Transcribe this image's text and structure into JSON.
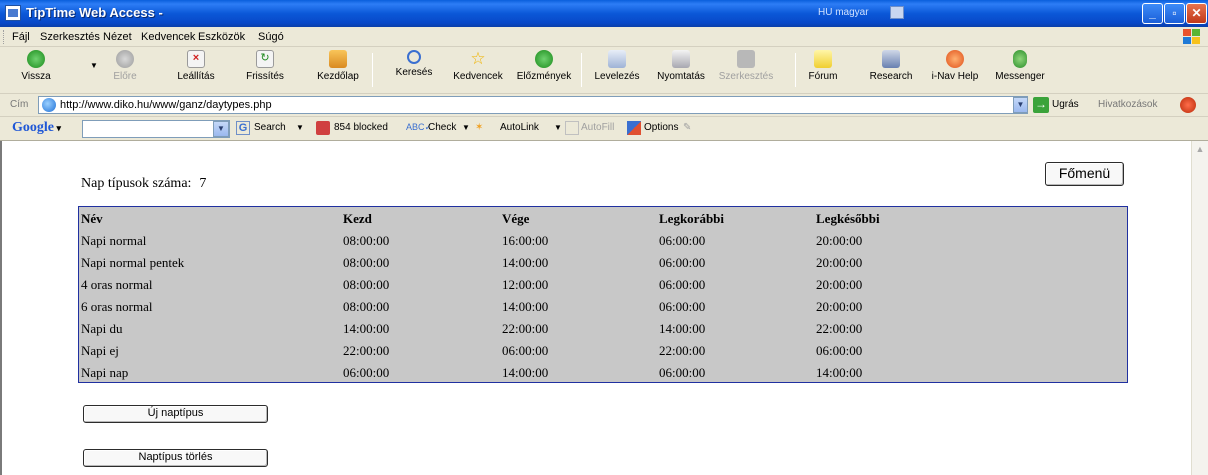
{
  "window": {
    "title": "TipTime Web Access -",
    "language": "HU magyar"
  },
  "menu": [
    "Fájl",
    "Szerkesztés",
    "Nézet",
    "Kedvencek",
    "Eszközök",
    "Súgó"
  ],
  "toolbar": {
    "back": "Vissza",
    "forward": "Előre",
    "stop": "Leállítás",
    "refresh": "Frissítés",
    "home": "Kezdőlap",
    "search": "Keresés",
    "favorites": "Kedvencek",
    "history": "Előzmények",
    "mail": "Levelezés",
    "print": "Nyomtatás",
    "edit": "Szerkesztés",
    "forum": "Fórum",
    "research": "Research",
    "inav": "i-Nav Help",
    "messenger": "Messenger"
  },
  "address": {
    "label": "Cím",
    "url": "http://www.diko.hu/www/ganz/daytypes.php",
    "go": "Ugrás",
    "links": "Hivatkozások"
  },
  "google": {
    "logo": "Google",
    "search": "Search",
    "blocked": "854 blocked",
    "check": "Check",
    "autolink": "AutoLink",
    "autofill": "AutoFill",
    "options": "Options"
  },
  "page": {
    "count_label": "Nap típusok száma:",
    "count_value": "7",
    "main_menu_button": "Főmenü",
    "new_button": "Új naptípus",
    "delete_button": "Naptípus törlés"
  },
  "table": {
    "headers": [
      "Név",
      "Kezd",
      "Vége",
      "Legkorábbi",
      "Legkésőbbi"
    ],
    "rows": [
      [
        "Napi normal",
        "08:00:00",
        "16:00:00",
        "06:00:00",
        "20:00:00"
      ],
      [
        "Napi normal pentek",
        "08:00:00",
        "14:00:00",
        "06:00:00",
        "20:00:00"
      ],
      [
        "4 oras normal",
        "08:00:00",
        "12:00:00",
        "06:00:00",
        "20:00:00"
      ],
      [
        "6 oras normal",
        "08:00:00",
        "14:00:00",
        "06:00:00",
        "20:00:00"
      ],
      [
        "Napi du",
        "14:00:00",
        "22:00:00",
        "14:00:00",
        "22:00:00"
      ],
      [
        "Napi ej",
        "22:00:00",
        "06:00:00",
        "22:00:00",
        "06:00:00"
      ],
      [
        "Napi nap",
        "06:00:00",
        "14:00:00",
        "06:00:00",
        "14:00:00"
      ]
    ]
  }
}
